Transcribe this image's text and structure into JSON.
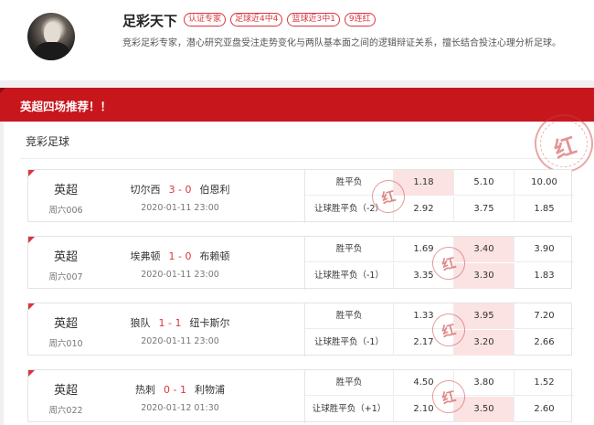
{
  "profile": {
    "name": "足彩天下",
    "tags": [
      "认证专家",
      "足球近4中4",
      "篮球近3中1",
      "9连红"
    ],
    "description": "竞彩足彩专家，潜心研究亚盘受注走势变化与两队基本面之间的逻辑辩证关系，擅长结合投注心理分析足球。"
  },
  "banner": {
    "title": "英超四场推荐！！"
  },
  "section": {
    "title": "竞彩足球",
    "stamp": "红"
  },
  "matches": [
    {
      "league": "英超",
      "code": "周六006",
      "home": "切尔西",
      "score": "3 - 0",
      "away": "伯恩利",
      "time": "2020-01-11 23:00",
      "rows": [
        {
          "label": "胜平负",
          "odds": [
            "1.18",
            "5.10",
            "10.00"
          ],
          "hit": 0
        },
        {
          "label": "让球胜平负（-2）",
          "odds": [
            "2.92",
            "3.75",
            "1.85"
          ],
          "hit": -1
        }
      ],
      "stamp": "红"
    },
    {
      "league": "英超",
      "code": "周六007",
      "home": "埃弗顿",
      "score": "1 - 0",
      "away": "布赖顿",
      "time": "2020-01-11 23:00",
      "rows": [
        {
          "label": "胜平负",
          "odds": [
            "1.69",
            "3.40",
            "3.90"
          ],
          "hit": 1
        },
        {
          "label": "让球胜平负（-1）",
          "odds": [
            "3.35",
            "3.30",
            "1.83"
          ],
          "hit": 1
        }
      ],
      "stamp": "红"
    },
    {
      "league": "英超",
      "code": "周六010",
      "home": "狼队",
      "score": "1 - 1",
      "away": "纽卡斯尔",
      "time": "2020-01-11 23:00",
      "rows": [
        {
          "label": "胜平负",
          "odds": [
            "1.33",
            "3.95",
            "7.20"
          ],
          "hit": 1
        },
        {
          "label": "让球胜平负（-1）",
          "odds": [
            "2.17",
            "3.20",
            "2.66"
          ],
          "hit": 1
        }
      ],
      "stamp": "红"
    },
    {
      "league": "英超",
      "code": "周六022",
      "home": "热刺",
      "score": "0 - 1",
      "away": "利物浦",
      "time": "2020-01-12 01:30",
      "rows": [
        {
          "label": "胜平负",
          "odds": [
            "4.50",
            "3.80",
            "1.52"
          ],
          "hit": -1
        },
        {
          "label": "让球胜平负（+1）",
          "odds": [
            "2.10",
            "3.50",
            "2.60"
          ],
          "hit": 1
        }
      ],
      "stamp": "红"
    }
  ]
}
